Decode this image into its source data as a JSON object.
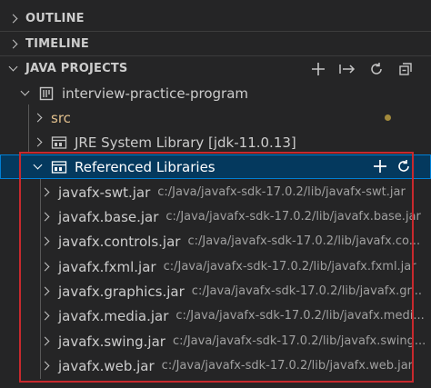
{
  "sections": {
    "outline": "OUTLINE",
    "timeline": "TIMELINE",
    "java_projects": "JAVA PROJECTS"
  },
  "project": {
    "name": "interview-practice-program",
    "src": "src",
    "jre": "JRE System Library [jdk-11.0.13]",
    "ref_libs": "Referenced Libraries"
  },
  "jars": [
    {
      "name": "javafx-swt.jar",
      "path": "c:/Java/javafx-sdk-17.0.2/lib/javafx-swt.jar"
    },
    {
      "name": "javafx.base.jar",
      "path": "c:/Java/javafx-sdk-17.0.2/lib/javafx.base.jar"
    },
    {
      "name": "javafx.controls.jar",
      "path": "c:/Java/javafx-sdk-17.0.2/lib/javafx.co..."
    },
    {
      "name": "javafx.fxml.jar",
      "path": "c:/Java/javafx-sdk-17.0.2/lib/javafx.fxml.jar"
    },
    {
      "name": "javafx.graphics.jar",
      "path": "c:/Java/javafx-sdk-17.0.2/lib/javafx.gr..."
    },
    {
      "name": "javafx.media.jar",
      "path": "c:/Java/javafx-sdk-17.0.2/lib/javafx.medi..."
    },
    {
      "name": "javafx.swing.jar",
      "path": "c:/Java/javafx-sdk-17.0.2/lib/javafx.swing..."
    },
    {
      "name": "javafx.web.jar",
      "path": "c:/Java/javafx-sdk-17.0.2/lib/javafx.web.jar"
    }
  ],
  "icons": {
    "header_actions": [
      "add-icon",
      "export-jar-icon",
      "refresh-icon",
      "collapse-all-icon"
    ],
    "ref_actions": [
      "add-icon",
      "refresh-icon"
    ]
  },
  "colors": {
    "background": "#252526",
    "selection": "#04395e",
    "selection_border": "#007fd4",
    "src_label": "#e2c08d",
    "highlight_box": "#c8292d"
  }
}
